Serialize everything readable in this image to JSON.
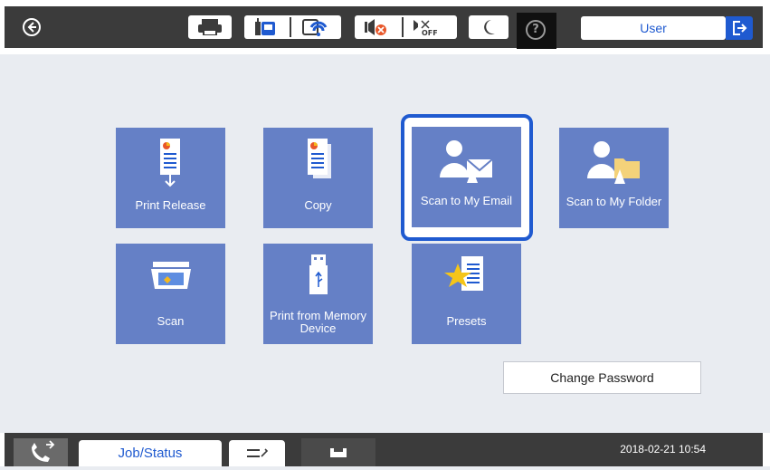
{
  "topbar": {
    "back_icon": "circle-arrow-left-icon",
    "status_icons": [
      "printer-icon",
      "fax-phone-icon",
      "wifi-icon",
      "mute-icon",
      "sound-off-icon",
      "sleep-moon-icon"
    ],
    "sound_off_label": "OFF",
    "help_label": "?",
    "user_label": "User",
    "logout_icon": "logout-icon"
  },
  "tiles": [
    {
      "label": "Print Release",
      "icon": "print-release-icon"
    },
    {
      "label": "Copy",
      "icon": "copy-icon"
    },
    {
      "label": "Scan to My Email",
      "icon": "scan-to-email-icon",
      "selected": true
    },
    {
      "label": "Scan to My Folder",
      "icon": "scan-to-folder-icon"
    },
    {
      "label": "Scan",
      "icon": "scan-icon"
    },
    {
      "label": "Print from Memory Device",
      "icon": "usb-memory-icon"
    },
    {
      "label": "Presets",
      "icon": "presets-star-icon"
    }
  ],
  "change_password_label": "Change Password",
  "bottombar": {
    "left_icon": "fax-log-icon",
    "job_status_label": "Job/Status",
    "stop_icon": "stop-icon",
    "tray_icon": "paper-tray-icon",
    "datetime": "2018-02-21 10:54"
  },
  "colors": {
    "accent": "#1f5ad0",
    "tile": "#6580c6",
    "bar": "#3b3b3b",
    "background": "#e9ecf1"
  }
}
